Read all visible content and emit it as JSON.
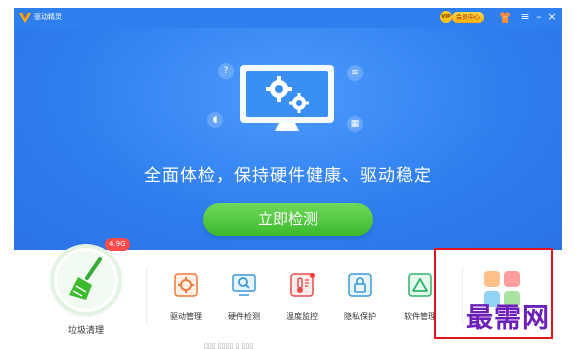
{
  "window": {
    "title": "驱动精灵",
    "vip_badge": "VIP",
    "member_center": "会员中心",
    "menu_glyph": "≡",
    "minimize_glyph": "–",
    "close_glyph": "×"
  },
  "hero": {
    "headline": "全面体检，保持硬件健康、驱动稳定",
    "detect_button": "立即检测",
    "float_icons": {
      "help": "?",
      "wifi": "≋",
      "speaker": "◖",
      "chip": "▦"
    }
  },
  "clean": {
    "label": "垃圾清理",
    "badge": "4.9G"
  },
  "tools": [
    {
      "name": "驱动管理",
      "icon": "gear-chip-icon",
      "color": "#f07a3c"
    },
    {
      "name": "硬件检测",
      "icon": "monitor-search-icon",
      "color": "#3a9ad9"
    },
    {
      "name": "温度监控",
      "icon": "thermometer-icon",
      "color": "#e84a4a",
      "dot": true
    },
    {
      "name": "隐私保护",
      "icon": "lock-icon",
      "color": "#3a9ad9"
    },
    {
      "name": "软件管理",
      "icon": "triangle-app-icon",
      "color": "#2fb36a"
    }
  ],
  "more": {
    "icon": "grid-tiles-icon"
  },
  "bottom_text": "▯▯▯ ▯▯▯▯ ▯ ▯▯▯",
  "watermark": "最需网",
  "colors": {
    "brand_blue": "#2f7fee",
    "button_green": "#3cba2e",
    "badge_red": "#ff4a4a",
    "highlight": "#e0141e",
    "watermark": "#6c20b8"
  }
}
